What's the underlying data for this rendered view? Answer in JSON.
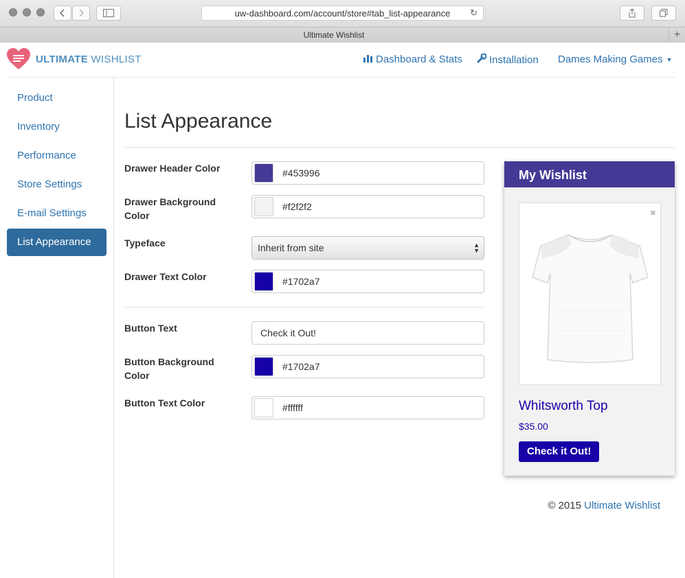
{
  "browser": {
    "url": "uw-dashboard.com/account/store#tab_list-appearance",
    "tab_title": "Ultimate Wishlist"
  },
  "brand": {
    "name_bold": "ULTIMATE",
    "name_light": "WISHLIST"
  },
  "topnav": {
    "dashboard": "Dashboard & Stats",
    "installation": "Installation",
    "account": "Dames Making Games"
  },
  "sidebar": {
    "items": [
      {
        "label": "Product"
      },
      {
        "label": "Inventory"
      },
      {
        "label": "Performance"
      },
      {
        "label": "Store Settings"
      },
      {
        "label": "E-mail Settings"
      },
      {
        "label": "List Appearance",
        "active": true
      }
    ]
  },
  "main": {
    "title": "List Appearance",
    "fields": {
      "drawer_header_color": {
        "label": "Drawer Header Color",
        "value": "#453996"
      },
      "drawer_background_color": {
        "label": "Drawer Background Color",
        "value": "#f2f2f2"
      },
      "typeface": {
        "label": "Typeface",
        "value": "Inherit from site"
      },
      "drawer_text_color": {
        "label": "Drawer Text Color",
        "value": "#1702a7"
      },
      "button_text": {
        "label": "Button Text",
        "value": "Check it Out!"
      },
      "button_background_color": {
        "label": "Button Background Color",
        "value": "#1702a7"
      },
      "button_text_color": {
        "label": "Button Text Color",
        "value": "#ffffff"
      }
    }
  },
  "preview": {
    "header": "My Wishlist",
    "product_name": "Whitsworth Top",
    "product_price": "$35.00",
    "button_label": "Check it Out!"
  },
  "footer": {
    "copyright": "© 2015",
    "link": "Ultimate Wishlist"
  },
  "colors": {
    "link": "#2f74b0",
    "sidebar_active": "#2f6a9c",
    "heart": "#e8637a"
  }
}
